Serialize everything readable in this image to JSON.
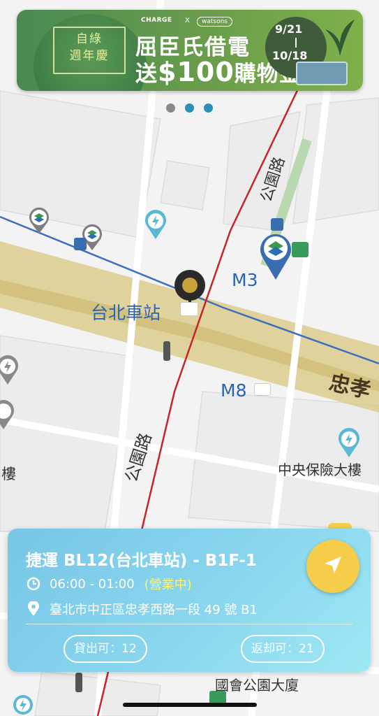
{
  "banner": {
    "frame_line1": "自綠",
    "frame_line2": "週年慶",
    "brand_left": "CHARGE",
    "brand_x": "X",
    "brand_right": "watsons",
    "headline_line1": "屈臣氏借電",
    "headline_pre": "送",
    "headline_amount": "$100",
    "headline_post": "購物金",
    "date_start": "9/21",
    "date_end": "10/18"
  },
  "carousel": {
    "total": 3,
    "active": 2
  },
  "map": {
    "road_gongyuan_top": "公園路",
    "road_gongyuan_bottom": "公園路",
    "road_zhongxiao": "忠孝",
    "station_main": "台北車站",
    "exit_m3": "M3",
    "exit_m8": "M8",
    "bldg_zhongyang": "中央保險大樓",
    "bldg_guohui": "國會公園大廈",
    "bldg_left": "樓"
  },
  "station_card": {
    "title": "捷運 BL12(台北車站) - B1F-1",
    "hours": "06:00 - 01:00",
    "status": "(營業中)",
    "address": "臺北市中正區忠孝西路一段 49 號 B1",
    "rent_available": "貸出可：12",
    "return_available": "返却可：21"
  },
  "colors": {
    "accent_yellow": "#f5cd4a",
    "card_blue": "#77c6e7",
    "status_yellow": "#fff36b",
    "banner_green": "#5a934d"
  },
  "icons": [
    "clock-icon",
    "location-pin-icon",
    "navigate-arrow-icon",
    "metro-taipei-marker-icon",
    "charge-marker-icon",
    "bus-stop-icon",
    "traffic-light-icon",
    "family-mart-icon"
  ]
}
